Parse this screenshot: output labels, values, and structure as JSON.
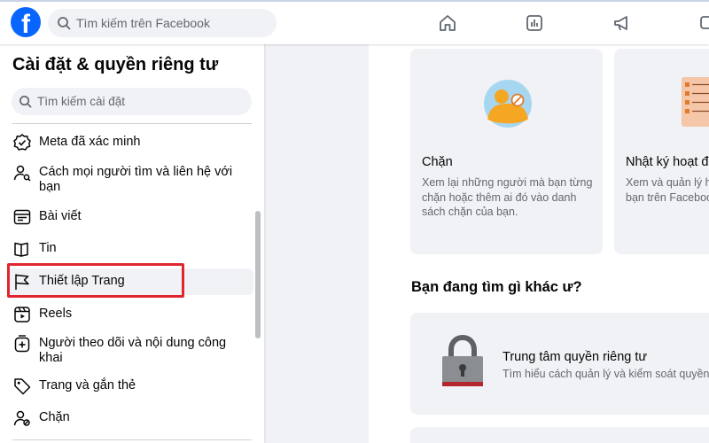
{
  "header": {
    "logo": "f",
    "search_placeholder": "Tìm kiếm trên Facebook",
    "nav_icons": [
      "home-icon",
      "pages-icon",
      "megaphone-icon",
      "gaming-icon"
    ]
  },
  "sidebar": {
    "title": "Cài đặt & quyền riêng tư",
    "search_placeholder": "Tìm kiếm cài đặt",
    "items": [
      {
        "label": "Meta đã xác minh",
        "icon": "verified-badge-icon"
      },
      {
        "label": "Cách mọi người tìm và liên hệ với bạn",
        "icon": "find-contact-icon"
      },
      {
        "label": "Bài viết",
        "icon": "posts-icon"
      },
      {
        "label": "Tin",
        "icon": "stories-icon"
      },
      {
        "label": "Thiết lập Trang",
        "icon": "flag-icon"
      },
      {
        "label": "Reels",
        "icon": "reels-icon"
      },
      {
        "label": "Người theo dõi và nội dung công khai",
        "icon": "followers-icon"
      },
      {
        "label": "Trang và gắn thẻ",
        "icon": "tag-icon"
      },
      {
        "label": "Chặn",
        "icon": "block-user-icon"
      }
    ]
  },
  "main": {
    "cards": [
      {
        "title": "Chặn",
        "description": "Xem lại những người mà bạn từng chặn hoặc thêm ai đó vào danh sách chặn của bạn.",
        "icon": "blocked-user-illustration"
      },
      {
        "title": "Nhật ký hoạt đ",
        "description": "Xem và quản lý h bạn trên Faceboo",
        "icon": "activity-log-illustration"
      }
    ],
    "section_title": "Bạn đang tìm gì khác ư?",
    "privacy_center": {
      "title": "Trung tâm quyền riêng tư",
      "description": "Tìm hiểu cách quản lý và kiểm soát quyền ri",
      "icon": "padlock-icon"
    }
  },
  "colors": {
    "brand": "#0866ff",
    "highlight": "#e0262d",
    "background": "#f0f2f5"
  }
}
